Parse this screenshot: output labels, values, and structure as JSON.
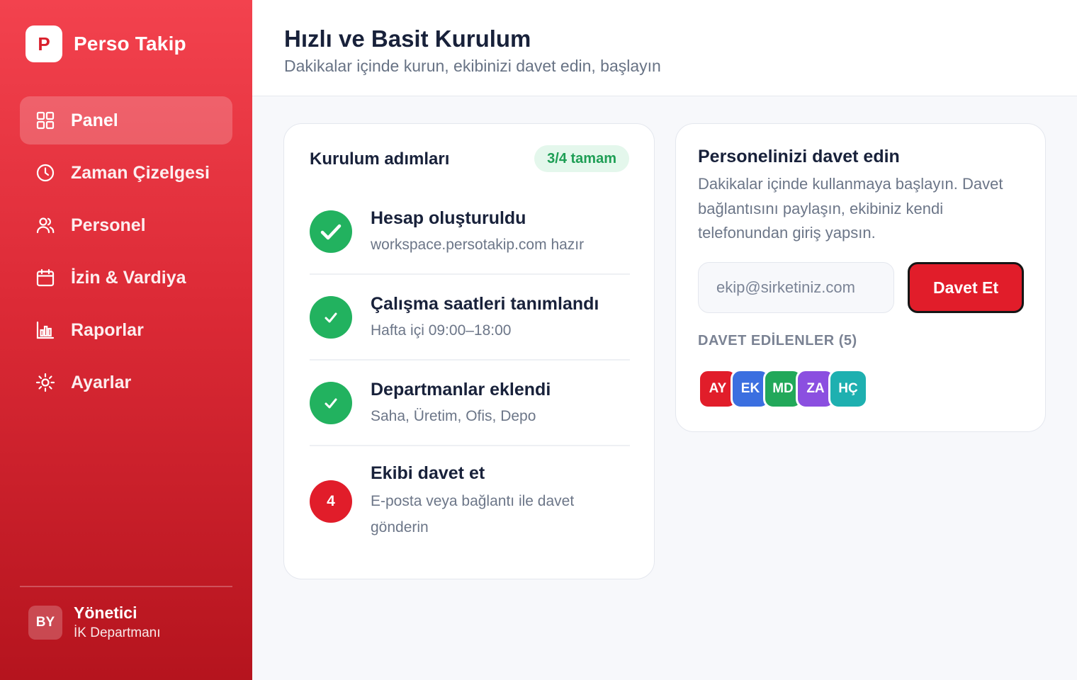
{
  "brand": {
    "logo_letter": "P",
    "name": "Perso Takip"
  },
  "sidebar": {
    "items": [
      {
        "label": "Panel",
        "icon": "grid-icon",
        "active": true
      },
      {
        "label": "Zaman Çizelgesi",
        "icon": "clock-icon",
        "active": false
      },
      {
        "label": "Personel",
        "icon": "users-icon",
        "active": false
      },
      {
        "label": "İzin & Vardiya",
        "icon": "calendar-icon",
        "active": false
      },
      {
        "label": "Raporlar",
        "icon": "bar-chart-icon",
        "active": false
      },
      {
        "label": "Ayarlar",
        "icon": "sun-gear-icon",
        "active": false
      }
    ],
    "user": {
      "initials": "BY",
      "name": "Yönetici",
      "role": "İK Departmanı"
    }
  },
  "header": {
    "title": "Hızlı ve Basit Kurulum",
    "subtitle": "Dakikalar içinde kurun, ekibinizi davet edin, başlayın"
  },
  "steps_card": {
    "title": "Kurulum adımları",
    "badge": "3/4 tamam",
    "steps": [
      {
        "title": "Hesap oluşturuldu",
        "desc": "workspace.persotakip.com hazır",
        "status": "done"
      },
      {
        "title": "Çalışma saatleri tanımlandı",
        "desc": "Hafta içi 09:00–18:00",
        "status": "done"
      },
      {
        "title": "Departmanlar eklendi",
        "desc": "Saha, Üretim, Ofis, Depo",
        "status": "done"
      },
      {
        "title": "Ekibi davet et",
        "desc": "E-posta veya bağlantı ile davet gönderin",
        "status": "todo",
        "number": "4"
      }
    ]
  },
  "invite_card": {
    "title": "Personelinizi davet edin",
    "desc": "Dakikalar içinde kullanmaya başlayın. Davet bağlantısını paylaşın, ekibiniz kendi telefonundan giriş yapsın.",
    "input_placeholder": "ekip@sirketiniz.com",
    "button_label": "Davet Et",
    "invited_label": "DAVET EDİLENLER (5)",
    "invited": [
      {
        "initials": "AY",
        "color": "#e11d2a"
      },
      {
        "initials": "EK",
        "color": "#3b6fe0"
      },
      {
        "initials": "MD",
        "color": "#22a85a"
      },
      {
        "initials": "ZA",
        "color": "#8b4fe0"
      },
      {
        "initials": "HÇ",
        "color": "#1eb0b0"
      }
    ]
  },
  "colors": {
    "brand_red": "#e11d2a",
    "success_green": "#22b25f",
    "badge_bg": "#e4f7ec"
  }
}
